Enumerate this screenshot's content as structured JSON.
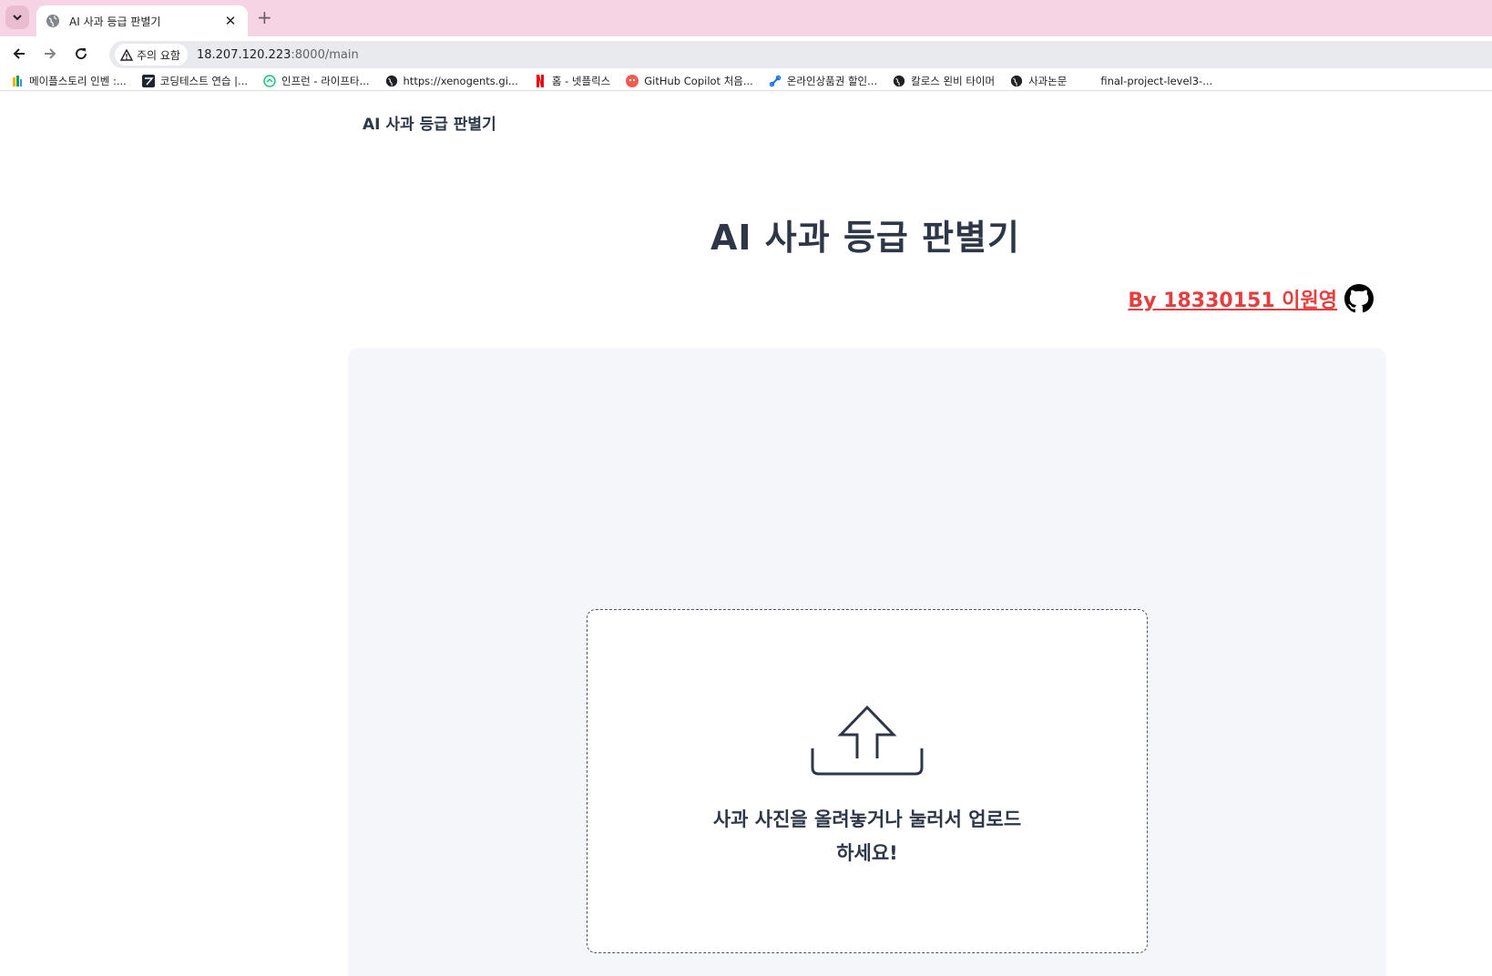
{
  "browser": {
    "tab": {
      "title": "AI 사과 등급 판별기",
      "close_glyph": "✕",
      "favicon": "globe-icon"
    },
    "new_tab_glyph": "+",
    "security_label": "주의 요함",
    "url_host": "18.207.120.223",
    "url_rest": ":8000/main",
    "bookmarks": [
      {
        "label": "메이플스토리 인벤 :...",
        "icon": "bookmark-inven-icon"
      },
      {
        "label": "코딩테스트 연습 |...",
        "icon": "bookmark-programmers-icon"
      },
      {
        "label": "인프런 - 라이프타...",
        "icon": "bookmark-inflearn-icon"
      },
      {
        "label": "https://xenogents.gi...",
        "icon": "globe-icon"
      },
      {
        "label": "홈 - 넷플릭스",
        "icon": "bookmark-netflix-icon"
      },
      {
        "label": "GitHub Copilot 처음...",
        "icon": "bookmark-copilot-icon"
      },
      {
        "label": "온라인상품권 할인...",
        "icon": "bookmark-link-icon"
      },
      {
        "label": "칼로스 왼비 타이머",
        "icon": "globe-icon"
      },
      {
        "label": "사과논문",
        "icon": "globe-icon"
      },
      {
        "label": "final-project-level3-...",
        "icon": ""
      }
    ]
  },
  "page": {
    "nav_brand": "AI 사과 등급 판별기",
    "title": "AI 사과 등급 판별기",
    "author_link": "By 18330151 이원영",
    "upload_text": "사과 사진을 올려놓거나 눌러서 업로드 하세요!"
  },
  "colors": {
    "tabstrip": "#f7d4e3",
    "heading": "#2d3748",
    "author_link": "#e53e3e",
    "panel_bg": "#f5f6f9"
  }
}
